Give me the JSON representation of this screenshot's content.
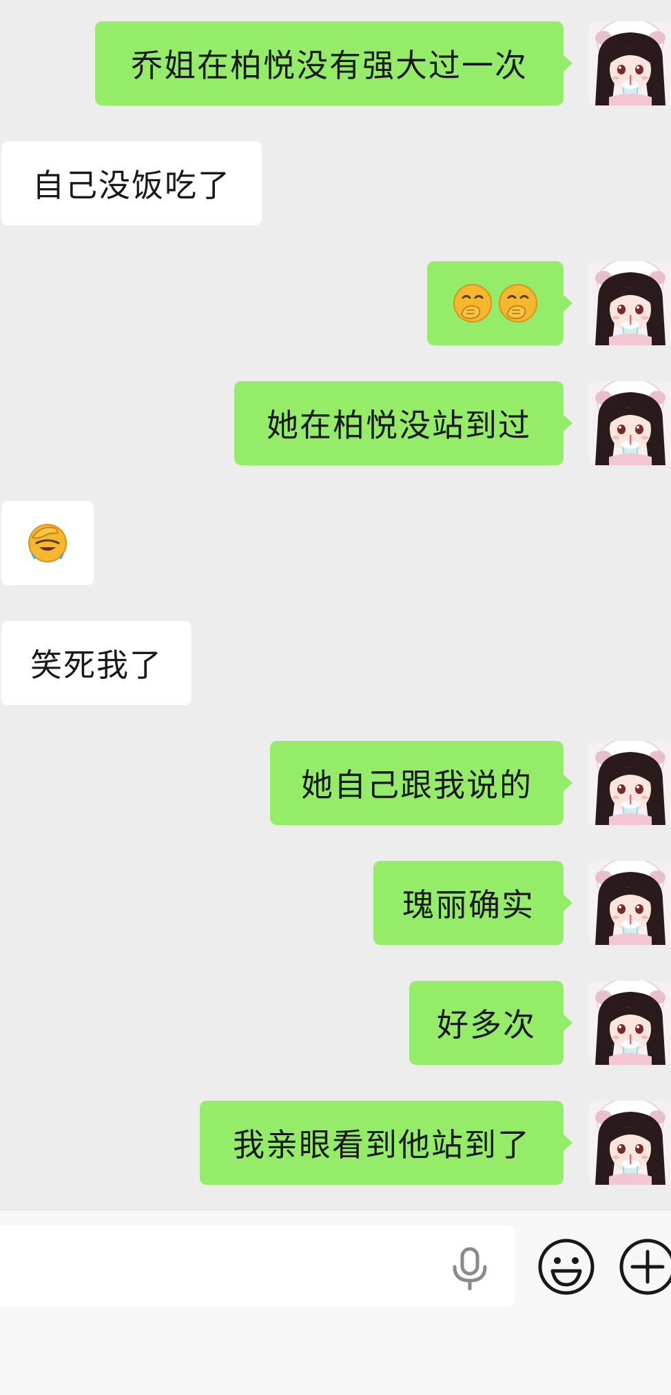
{
  "messages": [
    {
      "side": "sent",
      "type": "text",
      "text": "乔姐在柏悦没有强大过一次"
    },
    {
      "side": "recv",
      "type": "text",
      "text": "自己没饭吃了"
    },
    {
      "side": "sent",
      "type": "emoji",
      "emojis": [
        "hand-over-mouth-emoji",
        "hand-over-mouth-emoji"
      ]
    },
    {
      "side": "sent",
      "type": "text",
      "text": "她在柏悦没站到过"
    },
    {
      "side": "recv",
      "type": "emoji",
      "emojis": [
        "facepalm-emoji"
      ]
    },
    {
      "side": "recv",
      "type": "text",
      "text": "笑死我了"
    },
    {
      "side": "sent",
      "type": "text",
      "text": "她自己跟我说的"
    },
    {
      "side": "sent",
      "type": "text",
      "text": "瑰丽确实"
    },
    {
      "side": "sent",
      "type": "text",
      "text": "好多次"
    },
    {
      "side": "sent",
      "type": "text",
      "text": "我亲眼看到他站到了"
    }
  ],
  "input_bar": {
    "placeholder": "",
    "value": "",
    "icons": [
      "microphone-icon",
      "emoji-icon",
      "plus-icon"
    ]
  },
  "colors": {
    "chat_background": "#ededed",
    "sent_bubble": "#95ec69",
    "received_bubble": "#ffffff",
    "input_bar_background": "#f7f7f7"
  }
}
